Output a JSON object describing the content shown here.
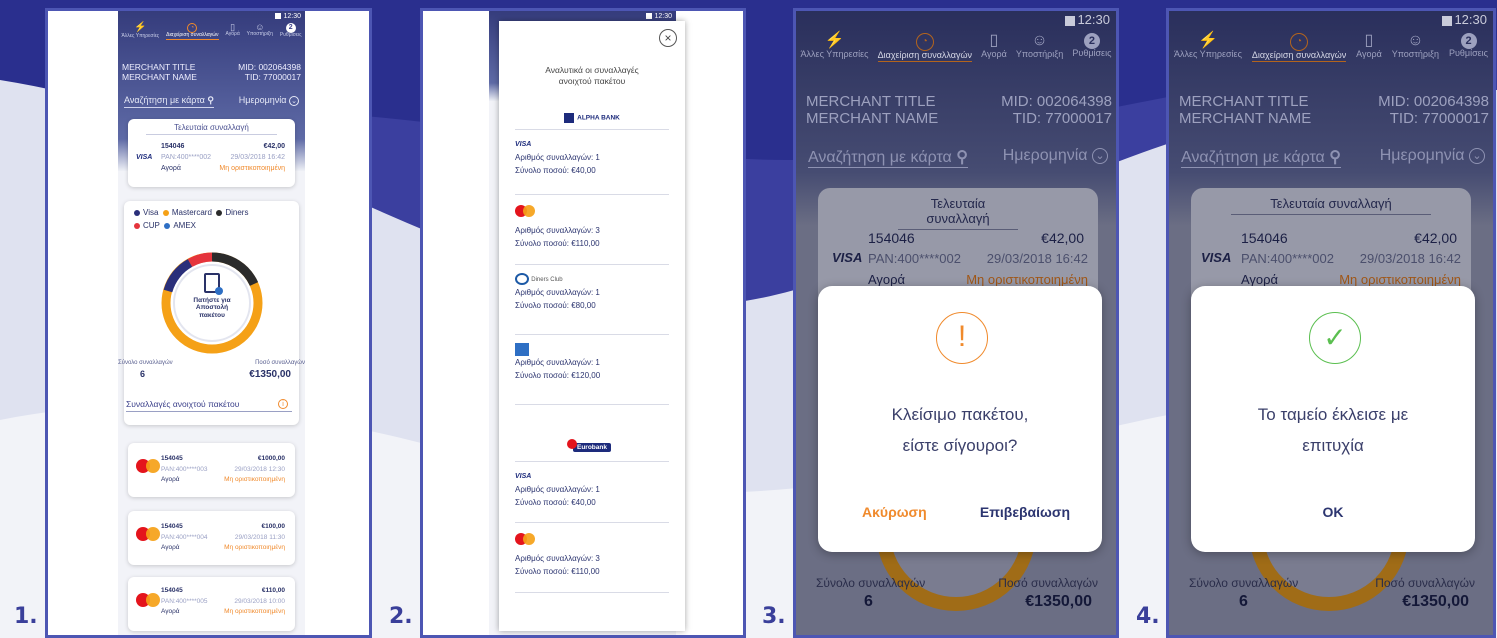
{
  "steps": [
    "1.",
    "2.",
    "3.",
    "4."
  ],
  "status_bar": {
    "time": "12:30"
  },
  "nav": {
    "items": [
      {
        "label": "Άλλες Υπηρεσίες"
      },
      {
        "label": "Διαχείριση συναλλαγών"
      },
      {
        "label": "Αγορά"
      },
      {
        "label": "Υποστήριξη"
      },
      {
        "label": "Ρυθμίσεις"
      }
    ],
    "badge": "2"
  },
  "merchant": {
    "title": "MERCHANT TITLE",
    "name": "MERCHANT NAME",
    "mid": "MID: 002064398",
    "tid": "TID: 77000017"
  },
  "search": {
    "card_label": "Αναζήτηση με κάρτα",
    "date_label": "Ημερομηνία"
  },
  "last_tx": {
    "title": "Τελευταία συναλλαγή",
    "id": "154046",
    "amount": "€42,00",
    "brand": "VISA",
    "pan": "PAN:400****002",
    "date": "29/03/2018 16:42",
    "type": "Αγορά",
    "status": "Μη οριστικοποιημένη"
  },
  "legend": {
    "items": [
      {
        "label": "Visa",
        "color": "#2a2f7a"
      },
      {
        "label": "Mastercard",
        "color": "#f5a117"
      },
      {
        "label": "Diners",
        "color": "#2b2b2b"
      },
      {
        "label": "CUP",
        "color": "#e5343c"
      },
      {
        "label": "AMEX",
        "color": "#2e6fc4"
      }
    ]
  },
  "package": {
    "center_label": "Πατήστε για Αποστολή πακέτου",
    "count_label": "Σύνολο συναλλαγών",
    "count": "6",
    "amount_label": "Ποσό συναλλαγών",
    "amount": "€1350,00",
    "open_link": "Συναλλαγές ανοιχτού πακέτου"
  },
  "tx_list": [
    {
      "id": "154045",
      "amount": "€1000,00",
      "pan": "PAN:400****003",
      "date": "29/03/2018 12:30",
      "type": "Αγορά",
      "status": "Μη οριστικοποιημένη"
    },
    {
      "id": "154045",
      "amount": "€100,00",
      "pan": "PAN:400****004",
      "date": "29/03/2018 11:30",
      "type": "Αγορά",
      "status": "Μη οριστικοποιημένη"
    },
    {
      "id": "154045",
      "amount": "€110,00",
      "pan": "PAN:400****005",
      "date": "29/03/2018 10:00",
      "type": "Αγορά",
      "status": "Μη οριστικοποιημένη"
    }
  ],
  "detail_modal": {
    "title": "Αναλυτικά οι συναλλαγές ανοιχτού πακέτου",
    "bank1": "ALPHA BANK",
    "bank2": "Eurobank",
    "diners": "Diners Club",
    "visa": "VISA",
    "blocks": [
      {
        "count": "Αριθμός συναλλαγών: 1",
        "total": "Σύνολο ποσού: €40,00"
      },
      {
        "count": "Αριθμός συναλλαγών: 3",
        "total": "Σύνολο ποσού: €110,00"
      },
      {
        "count": "Αριθμός συναλλαγών: 1",
        "total": "Σύνολο ποσού: €80,00"
      },
      {
        "count": "Αριθμός συναλλαγών: 1",
        "total": "Σύνολο ποσού: €120,00"
      },
      {
        "count": "Αριθμός συναλλαγών: 1",
        "total": "Σύνολο ποσού: €40,00"
      },
      {
        "count": "Αριθμός συναλλαγών: 3",
        "total": "Σύνολο ποσού: €110,00"
      }
    ]
  },
  "confirm_dialog": {
    "line1": "Κλείσιμο πακέτου,",
    "line2": "είστε σίγουροι?",
    "cancel": "Ακύρωση",
    "confirm": "Επιβεβαίωση"
  },
  "success_dialog": {
    "line1": "Το ταμείο έκλεισε με",
    "line2": "επιτυχία",
    "ok": "OK"
  },
  "colors": {
    "accent": "#f08a2c",
    "primary": "#2c3570",
    "background": "#2b3192",
    "success": "#5bbf50"
  }
}
